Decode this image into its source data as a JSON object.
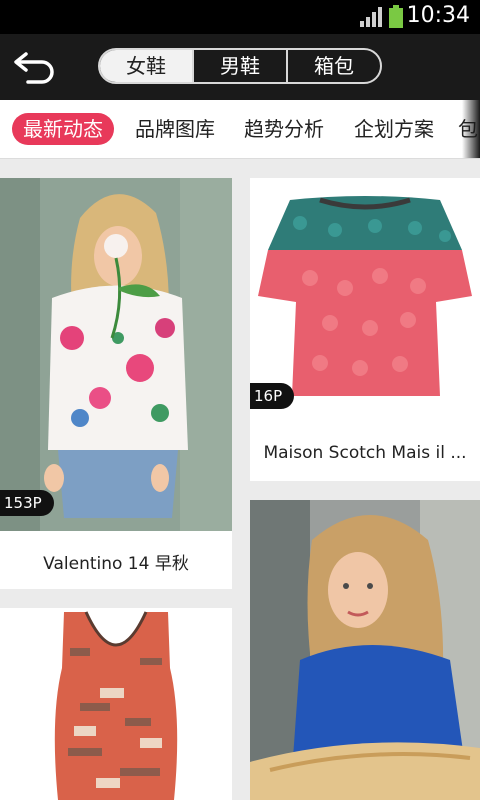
{
  "status_bar": {
    "time": "10:34",
    "signal_icon": "signal-icon",
    "battery_icon": "battery-icon",
    "battery_color": "#7ac943"
  },
  "header": {
    "back_icon": "back-arrow-icon",
    "segments": [
      {
        "label": "女鞋",
        "active": true
      },
      {
        "label": "男鞋",
        "active": false
      },
      {
        "label": "箱包",
        "active": false
      }
    ]
  },
  "tabs": [
    {
      "label": "最新动态",
      "active": true
    },
    {
      "label": "品牌图库",
      "active": false
    },
    {
      "label": "趋势分析",
      "active": false
    },
    {
      "label": "企划方案",
      "active": false
    },
    {
      "label": "包",
      "active": false
    }
  ],
  "accent_color": "#e8395a",
  "cards": [
    {
      "caption": "Valentino 14 早秋",
      "count": "153P",
      "image": "model-floral-shirt-rose"
    },
    {
      "caption": "Maison Scotch Mais il ...",
      "count": "16P",
      "image": "lace-top-pink-teal"
    },
    {
      "caption": "",
      "count": "",
      "image": "printed-wrap-dress"
    },
    {
      "caption": "",
      "count": "",
      "image": "model-blue-jacket"
    }
  ]
}
